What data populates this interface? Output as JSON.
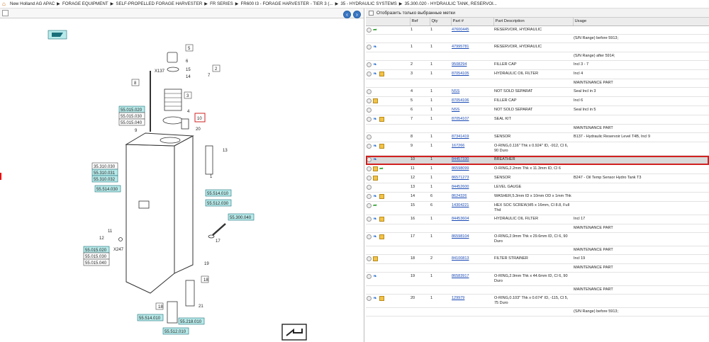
{
  "breadcrumb": {
    "items": [
      "New Holland AG APAC",
      "FORAGE EQUIPMENT",
      "SELF-PROPELLED FORAGE HARVESTER",
      "FR SERIES",
      "FR600 I3 - FORAGE HARVESTER - TIER 3 (...",
      "35 - HYDRAULIC SYSTEMS",
      "35.300.020 - HYDRAULIC TANK, RESERVOI..."
    ]
  },
  "diagram": {
    "callouts": [
      "5",
      "6",
      "15",
      "14",
      "3",
      "2",
      "7",
      "8",
      "X137",
      "4",
      "10",
      "20",
      "9",
      "13",
      "1",
      "11",
      "12",
      "X247",
      "17",
      "19",
      "18",
      "18",
      "21"
    ],
    "refs_top": [
      "55.015.020",
      "55.015.030",
      "55.015.040"
    ],
    "refs_mid": [
      "35.310.030",
      "55.310.031",
      "55.310.032",
      "55.514.030"
    ],
    "refs_right": [
      "55.514.010",
      "55.512.030",
      "55.300.040"
    ],
    "refs_lower": [
      "55.015.020",
      "55.015.030",
      "55.015.040"
    ],
    "refs_bottom": [
      "55.514.010",
      "55.218.010",
      "55.512.010"
    ]
  },
  "right": {
    "filter_label": "Отобразить только выбранные метки",
    "columns": [
      "",
      "Ref",
      "Qty",
      "Part #",
      "Part Description",
      "Usage"
    ],
    "rows": [
      {
        "icons": [
          "plus",
          "arrow"
        ],
        "ref": "1",
        "qty": "1",
        "part": "47600445",
        "desc": "RESERVOIR, HYDRAULIC",
        "usage": ""
      },
      {
        "icons": [],
        "ref": "",
        "qty": "",
        "part": "",
        "desc": "",
        "usage": "(S/N Range) before 5913;"
      },
      {
        "icons": [
          "plus",
          "wrench"
        ],
        "ref": "1",
        "qty": "1",
        "part": "47995781",
        "desc": "RESERVOIR, HYDRAULIC",
        "usage": ""
      },
      {
        "icons": [],
        "ref": "",
        "qty": "",
        "part": "",
        "desc": "",
        "usage": "(S/N Range) after 5914;"
      },
      {
        "icons": [
          "plus",
          "wrench"
        ],
        "ref": "2",
        "qty": "1",
        "part": "9508294",
        "desc": "FILLER CAP",
        "usage": "Incl 3 - 7"
      },
      {
        "icons": [
          "plus",
          "wrench",
          "box"
        ],
        "ref": "3",
        "qty": "1",
        "part": "87054105",
        "desc": "HYDRAULIC OIL FILTER",
        "usage": "Incl 4"
      },
      {
        "icons": [],
        "ref": "",
        "qty": "",
        "part": "",
        "desc": "",
        "usage": "MAINTENANCE PART"
      },
      {
        "icons": [
          "plus"
        ],
        "ref": "4",
        "qty": "1",
        "part": "NSS",
        "desc": "NOT SOLD SEPARAT",
        "usage": "Seal Incl in 3"
      },
      {
        "icons": [
          "plus",
          "box"
        ],
        "ref": "5",
        "qty": "1",
        "part": "87054106",
        "desc": "FILLER CAP",
        "usage": "Incl 6"
      },
      {
        "icons": [
          "plus"
        ],
        "ref": "6",
        "qty": "1",
        "part": "NSS",
        "desc": "NOT SOLD SEPARAT",
        "usage": "Seal Incl in 5"
      },
      {
        "icons": [
          "plus",
          "wrench",
          "box"
        ],
        "ref": "7",
        "qty": "1",
        "part": "87054107",
        "desc": "SEAL KIT",
        "usage": ""
      },
      {
        "icons": [],
        "ref": "",
        "qty": "",
        "part": "",
        "desc": "",
        "usage": "MAINTENANCE PART"
      },
      {
        "icons": [
          "plus"
        ],
        "ref": "8",
        "qty": "1",
        "part": "87341419",
        "desc": "SENSOR",
        "usage": "B137 - Hydraulic Reservoir Level T4B, Incl 9"
      },
      {
        "icons": [
          "plus",
          "wrench",
          "box"
        ],
        "ref": "9",
        "qty": "1",
        "part": "167266",
        "desc": "O-RING,0.116\" Thk x 0.924\" ID, -912, Cl 6, 90 Duro",
        "usage": ""
      },
      {
        "icons": [
          "plus",
          "wrench"
        ],
        "ref": "10",
        "qty": "1",
        "part": "84457330",
        "desc": "BREATHER",
        "usage": "",
        "selected": true
      },
      {
        "icons": [
          "plus",
          "box",
          "arrow"
        ],
        "ref": "11",
        "qty": "1",
        "part": "86598099",
        "desc": "O-RING,2.2mm Thk x 11.3mm ID, Cl 6",
        "usage": ""
      },
      {
        "icons": [
          "plus",
          "box"
        ],
        "ref": "12",
        "qty": "1",
        "part": "86571273",
        "desc": "SENSOR",
        "usage": "B247 - Oil Temp Sensor Hydro Tank T3"
      },
      {
        "icons": [
          "plus"
        ],
        "ref": "13",
        "qty": "1",
        "part": "84452600",
        "desc": "LEVEL GAUGE",
        "usage": ""
      },
      {
        "icons": [
          "plus",
          "wrench",
          "box"
        ],
        "ref": "14",
        "qty": "6",
        "part": "8624326",
        "desc": "WASHER,5.3mm ID x 10mm OD x 1mm Thk",
        "usage": ""
      },
      {
        "icons": [
          "plus",
          "arrow"
        ],
        "ref": "15",
        "qty": "6",
        "part": "14304221",
        "desc": "HEX SOC SCREW,M5 x 16mm, Cl 8.8, Full Thd",
        "usage": ""
      },
      {
        "icons": [
          "plus",
          "wrench",
          "box"
        ],
        "ref": "16",
        "qty": "1",
        "part": "84453604",
        "desc": "HYDRAULIC OIL FILTER",
        "usage": "Incl 17"
      },
      {
        "icons": [],
        "ref": "",
        "qty": "",
        "part": "",
        "desc": "",
        "usage": "MAINTENANCE PART"
      },
      {
        "icons": [
          "plus",
          "wrench",
          "box"
        ],
        "ref": "17",
        "qty": "1",
        "part": "86598104",
        "desc": "O-RING,2.9mm Thk x 29.6mm ID, Cl 6, 90 Duro",
        "usage": ""
      },
      {
        "icons": [],
        "ref": "",
        "qty": "",
        "part": "",
        "desc": "",
        "usage": "MAINTENANCE PART"
      },
      {
        "icons": [
          "plus",
          "box"
        ],
        "ref": "18",
        "qty": "2",
        "part": "84100813",
        "desc": "FILTER STRAINER",
        "usage": "Incl 19"
      },
      {
        "icons": [],
        "ref": "",
        "qty": "",
        "part": "",
        "desc": "",
        "usage": "MAINTENANCE PART"
      },
      {
        "icons": [
          "plus",
          "wrench"
        ],
        "ref": "19",
        "qty": "1",
        "part": "86583917",
        "desc": "O-RING,2.9mm Thk x 44.6mm ID, Cl 6, 90 Duro",
        "usage": ""
      },
      {
        "icons": [],
        "ref": "",
        "qty": "",
        "part": "",
        "desc": "",
        "usage": "MAINTENANCE PART"
      },
      {
        "icons": [
          "plus",
          "wrench",
          "box"
        ],
        "ref": "20",
        "qty": "1",
        "part": "129979",
        "desc": "O-RING,0.103\" Thk x 0.674\" ID, -115, Cl 5, 75 Duro",
        "usage": ""
      },
      {
        "icons": [],
        "ref": "",
        "qty": "",
        "part": "",
        "desc": "",
        "usage": "(S/N Range) before 5913;"
      }
    ]
  },
  "colors": {
    "accent": "#1747b3",
    "selected_outline": "#d12020",
    "ref_highlight": "#b9eaea"
  }
}
